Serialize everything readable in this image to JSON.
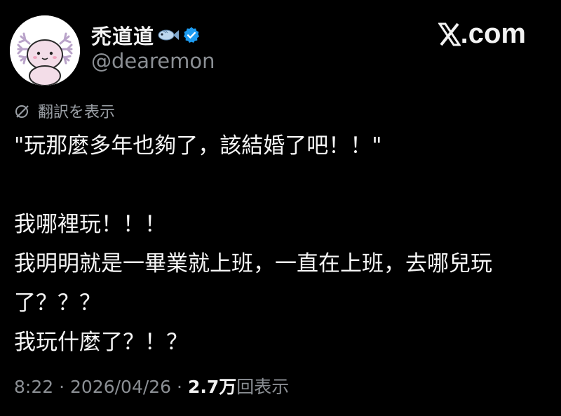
{
  "profile": {
    "display_name": "禿道道",
    "handle": "@dearemon",
    "avatar_icon": "axolotl-avatar-icon",
    "verified_icon": "verified-badge-icon",
    "verified_color": "#1d9bf0",
    "name_emoji_icon": "fish-icon"
  },
  "brand": {
    "label": ".com",
    "logo_icon": "x-logo-icon"
  },
  "translate": {
    "label": "翻訳を表示",
    "icon": "translate-icon"
  },
  "tweet": {
    "lines": [
      "\"玩那麼多年也夠了，該結婚了吧！！\"",
      "",
      "我哪裡玩！！！",
      "我明明就是一畢業就上班，一直在上班，去哪兒玩",
      "了？？？",
      "我玩什麼了？！？"
    ]
  },
  "meta": {
    "time": "8:22",
    "separator": "·",
    "date": "2026/04/26",
    "views_count": "2.7万",
    "views_label": "回表示"
  },
  "colors": {
    "background": "#000000",
    "primary_text": "#f5f5f5",
    "secondary_text": "#8b8f94",
    "verified": "#1d9bf0"
  }
}
